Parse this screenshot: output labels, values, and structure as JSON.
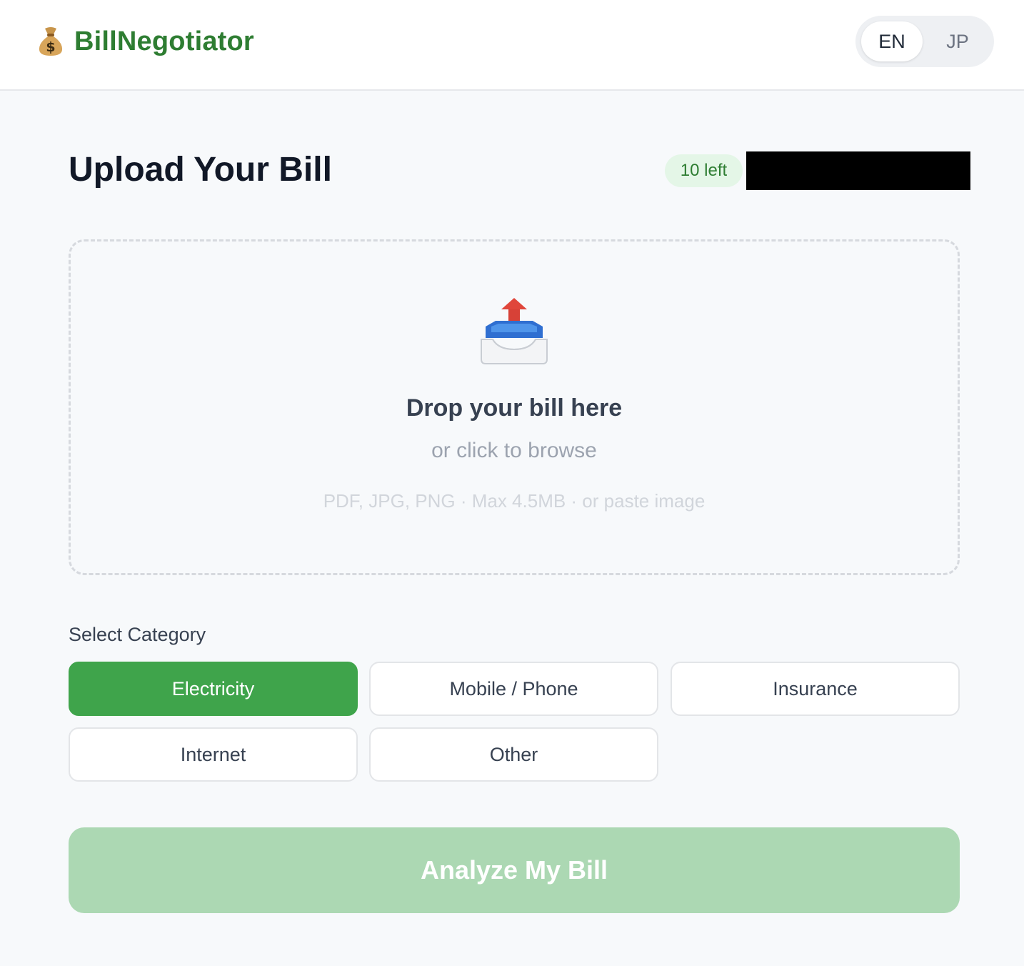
{
  "header": {
    "brand_icon": "money-bag-icon",
    "brand_name": "BillNegotiator",
    "languages": [
      {
        "label": "EN",
        "active": true
      },
      {
        "label": "JP",
        "active": false
      }
    ]
  },
  "main": {
    "title": "Upload Your Bill",
    "remaining_badge": "10 left",
    "dropzone": {
      "icon": "inbox-upload-icon",
      "title": "Drop your bill here",
      "subtitle": "or click to browse",
      "hint": "PDF, JPG, PNG · Max 4.5MB · or paste image"
    },
    "category": {
      "label": "Select Category",
      "options": [
        {
          "label": "Electricity",
          "selected": true
        },
        {
          "label": "Mobile / Phone",
          "selected": false
        },
        {
          "label": "Insurance",
          "selected": false
        },
        {
          "label": "Internet",
          "selected": false
        },
        {
          "label": "Other",
          "selected": false
        }
      ]
    },
    "analyze_button": "Analyze My Bill"
  },
  "colors": {
    "brand_green": "#2e7d32",
    "selected_green": "#3fa44b",
    "disabled_button": "#acd8b3",
    "badge_bg": "#e4f6e7"
  }
}
